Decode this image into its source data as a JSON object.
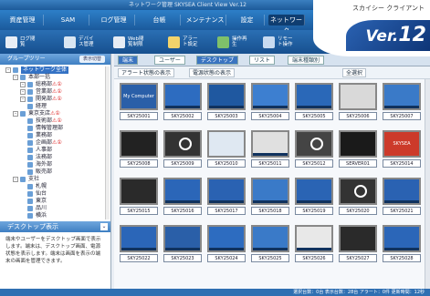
{
  "titlebar": {
    "title": "ネットワーク管理  SKYSEA Client View Ver.12"
  },
  "brand": {
    "subtitle": "スカイシー クライアント",
    "version_prefix": "Ver.",
    "version_number": "12"
  },
  "menu": [
    "資産管理",
    "SAM",
    "ログ管理",
    "台帳",
    "メンテナンス",
    "設定",
    "ネットワーク"
  ],
  "menu_active_index": 6,
  "toolbar": [
    {
      "label": "ログ閲覧",
      "icon": "log-icon"
    },
    {
      "label": "デバイス管理",
      "icon": "device-icon"
    },
    {
      "label": "Web閲覧制限",
      "icon": "web-icon"
    },
    {
      "label": "アラート設定",
      "icon": "alert-icon"
    },
    {
      "label": "操作再生",
      "icon": "play-icon"
    },
    {
      "label": "リモート操作",
      "icon": "remote-icon"
    }
  ],
  "groups": {
    "header": "グループツリー",
    "button": "表示切替",
    "items": [
      {
        "label": "ネットワーク全体",
        "level": 0,
        "expanded": "-",
        "selected": true,
        "warn": ""
      },
      {
        "label": "本部一括",
        "level": 1,
        "expanded": "-",
        "selected": false,
        "warn": ""
      },
      {
        "label": "総務部",
        "level": 2,
        "expanded": "-",
        "selected": false,
        "warn": "⚠①"
      },
      {
        "label": "営業部",
        "level": 2,
        "expanded": "-",
        "selected": false,
        "warn": "⚠①"
      },
      {
        "label": "開発部",
        "level": 2,
        "expanded": "-",
        "selected": false,
        "warn": "⚠①"
      },
      {
        "label": "経理",
        "level": 2,
        "expanded": "",
        "selected": false,
        "warn": ""
      },
      {
        "label": "東京支店",
        "level": 1,
        "expanded": "-",
        "selected": false,
        "warn": "⚠①"
      },
      {
        "label": "技術部",
        "level": 2,
        "expanded": "",
        "selected": false,
        "warn": "⚠①"
      },
      {
        "label": "情報管理部",
        "level": 2,
        "expanded": "",
        "selected": false,
        "warn": ""
      },
      {
        "label": "業務部",
        "level": 2,
        "expanded": "",
        "selected": false,
        "warn": ""
      },
      {
        "label": "企画部",
        "level": 2,
        "expanded": "",
        "selected": false,
        "warn": "⚠①"
      },
      {
        "label": "人事部",
        "level": 2,
        "expanded": "",
        "selected": false,
        "warn": ""
      },
      {
        "label": "法務部",
        "level": 2,
        "expanded": "",
        "selected": false,
        "warn": ""
      },
      {
        "label": "海外部",
        "level": 2,
        "expanded": "",
        "selected": false,
        "warn": ""
      },
      {
        "label": "販売部",
        "level": 2,
        "expanded": "",
        "selected": false,
        "warn": ""
      },
      {
        "label": "支社",
        "level": 1,
        "expanded": "-",
        "selected": false,
        "warn": ""
      },
      {
        "label": "札幌",
        "level": 2,
        "expanded": "",
        "selected": false,
        "warn": ""
      },
      {
        "label": "仙台",
        "level": 2,
        "expanded": "",
        "selected": false,
        "warn": ""
      },
      {
        "label": "東京",
        "level": 2,
        "expanded": "",
        "selected": false,
        "warn": ""
      },
      {
        "label": "品川",
        "level": 2,
        "expanded": "",
        "selected": false,
        "warn": ""
      },
      {
        "label": "横浜",
        "level": 2,
        "expanded": "",
        "selected": false,
        "warn": ""
      }
    ]
  },
  "desktop_panel": {
    "title": "デスクトップ表示",
    "chev": "⌄",
    "text": "端末やユーザーをデスクトップ画面で表示します。端末は、デスクトップ画面、電源状態を表示します。端末は画面を表示の端末の画面を管理できます。"
  },
  "tabs": [
    {
      "label": "端末",
      "selected": true
    },
    {
      "label": "ユーザー",
      "selected": false
    },
    {
      "label": "デスクトップ",
      "selected": true
    },
    {
      "label": "リスト",
      "selected": false
    },
    {
      "label": "端末種類別",
      "selected": false
    }
  ],
  "filters": [
    {
      "label": "アラート状態の表示"
    },
    {
      "label": "電源状態の表示"
    },
    {
      "label": "全選択"
    }
  ],
  "computers": [
    {
      "label": "SKY25001",
      "kind": "text",
      "text": "My Computer",
      "bg": "#2a5fa8"
    },
    {
      "label": "SKY25002",
      "kind": "win",
      "text": "",
      "bg": "#2d6cc0"
    },
    {
      "label": "SKY25003",
      "kind": "win",
      "text": "",
      "bg": "#1f58a0"
    },
    {
      "label": "SKY25004",
      "kind": "win",
      "text": "",
      "bg": "#3d7fd0"
    },
    {
      "label": "SKY25005",
      "kind": "win",
      "text": "",
      "bg": "#2a68b8"
    },
    {
      "label": "SKY25006",
      "kind": "off",
      "text": "",
      "bg": "#d9d9d9"
    },
    {
      "label": "SKY25007",
      "kind": "win",
      "text": "",
      "bg": "#3a7ac8"
    },
    {
      "label": "SKY25008",
      "kind": "dark",
      "text": "",
      "bg": "#222"
    },
    {
      "label": "SKY25009",
      "kind": "power",
      "text": "",
      "bg": "#333"
    },
    {
      "label": "SKY25010",
      "kind": "app",
      "text": "",
      "bg": "#dfe8f2"
    },
    {
      "label": "SKY25011",
      "kind": "win",
      "text": "",
      "bg": "#e0e0e0"
    },
    {
      "label": "SKY25012",
      "kind": "lock",
      "text": "",
      "bg": "#444"
    },
    {
      "label": "SERVER01",
      "kind": "dark",
      "text": "",
      "bg": "#1a1a1a"
    },
    {
      "label": "SKY25014",
      "kind": "text",
      "text": "SKYSEA",
      "bg": "#cc3a2a"
    },
    {
      "label": "SKY25015",
      "kind": "dark",
      "text": "",
      "bg": "#2a2a2a"
    },
    {
      "label": "SKY25016",
      "kind": "win",
      "text": "",
      "bg": "#2b66b8"
    },
    {
      "label": "SKY25017",
      "kind": "win",
      "text": "",
      "bg": "#2a62b2"
    },
    {
      "label": "SKY25018",
      "kind": "win",
      "text": "",
      "bg": "#3a7ac8"
    },
    {
      "label": "SKY25019",
      "kind": "win",
      "text": "",
      "bg": "#2a64b4"
    },
    {
      "label": "SKY25020",
      "kind": "power",
      "text": "",
      "bg": "#333"
    },
    {
      "label": "SKY25021",
      "kind": "win",
      "text": "",
      "bg": "#2a62b2"
    },
    {
      "label": "SKY25022",
      "kind": "win",
      "text": "",
      "bg": "#2b66b8"
    },
    {
      "label": "SKY25023",
      "kind": "win",
      "text": "",
      "bg": "#2a5fa8"
    },
    {
      "label": "SKY25024",
      "kind": "win",
      "text": "",
      "bg": "#2d6cc0"
    },
    {
      "label": "SKY25025",
      "kind": "win",
      "text": "",
      "bg": "#3a7ac8"
    },
    {
      "label": "SKY25026",
      "kind": "win",
      "text": "",
      "bg": "#e8e8e8"
    },
    {
      "label": "SKY25027",
      "kind": "dark",
      "text": "",
      "bg": "#2a2a2a"
    },
    {
      "label": "SKY25028",
      "kind": "win",
      "text": "",
      "bg": "#2b66b8"
    }
  ],
  "status": {
    "text": "選択台数：0台  表示台数：28台  アラート：0件  更新時間：12秒"
  }
}
